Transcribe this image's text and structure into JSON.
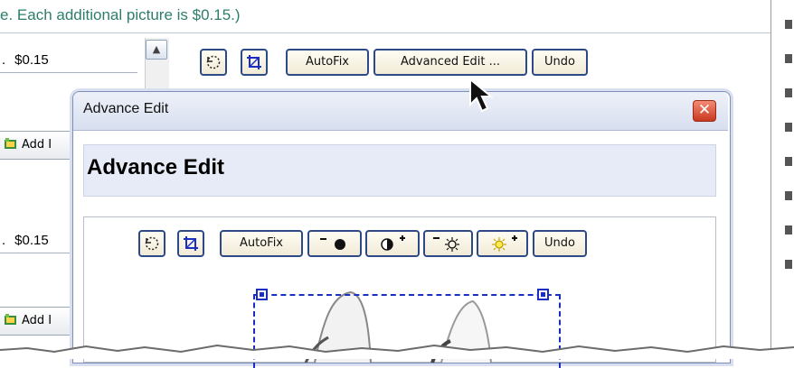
{
  "notice": {
    "text": "e. Each additional picture is $0.15.)"
  },
  "rows": [
    {
      "price_prefix": ".",
      "price": "$0.15",
      "add_label": "Add I"
    },
    {
      "price_prefix": ".",
      "price": "$0.15",
      "add_label": "Add I"
    }
  ],
  "page_toolbar": {
    "rotate_icon": "rotate-icon",
    "crop_icon": "crop-icon",
    "autofix": "AutoFix",
    "advanced_edit": "Advanced Edit ...",
    "undo": "Undo"
  },
  "dialog": {
    "window_title": "Advance Edit",
    "heading": "Advance Edit",
    "close_icon": "close-icon",
    "toolbar": {
      "autofix": "AutoFix",
      "undo": "Undo",
      "darken_icon": "darken-icon",
      "contrast_icon": "contrast-icon",
      "brightness_down_icon": "brightness-down-icon",
      "brightness_up_icon": "brightness-up-icon"
    }
  },
  "colors": {
    "accent_border": "#2c4a86",
    "notice_text": "#2e7d6b",
    "selection": "#1a2fc0",
    "close_red": "#c8391f"
  }
}
